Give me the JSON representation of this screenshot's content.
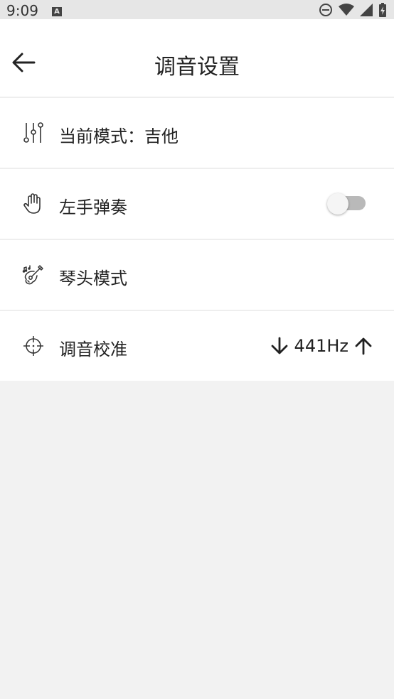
{
  "status_bar": {
    "time": "9:09",
    "notification_icon": "A"
  },
  "header": {
    "title": "调音设置",
    "back_icon": "arrow-left-icon"
  },
  "settings": {
    "mode": {
      "label": "当前模式：吉他",
      "icon": "sliders-icon"
    },
    "left_hand": {
      "label": "左手弹奏",
      "icon": "hand-icon",
      "enabled": false
    },
    "headstock": {
      "label": "琴头模式",
      "icon": "guitar-icon"
    },
    "calibration": {
      "label": "调音校准",
      "icon": "crosshair-icon",
      "value": "441Hz"
    }
  }
}
